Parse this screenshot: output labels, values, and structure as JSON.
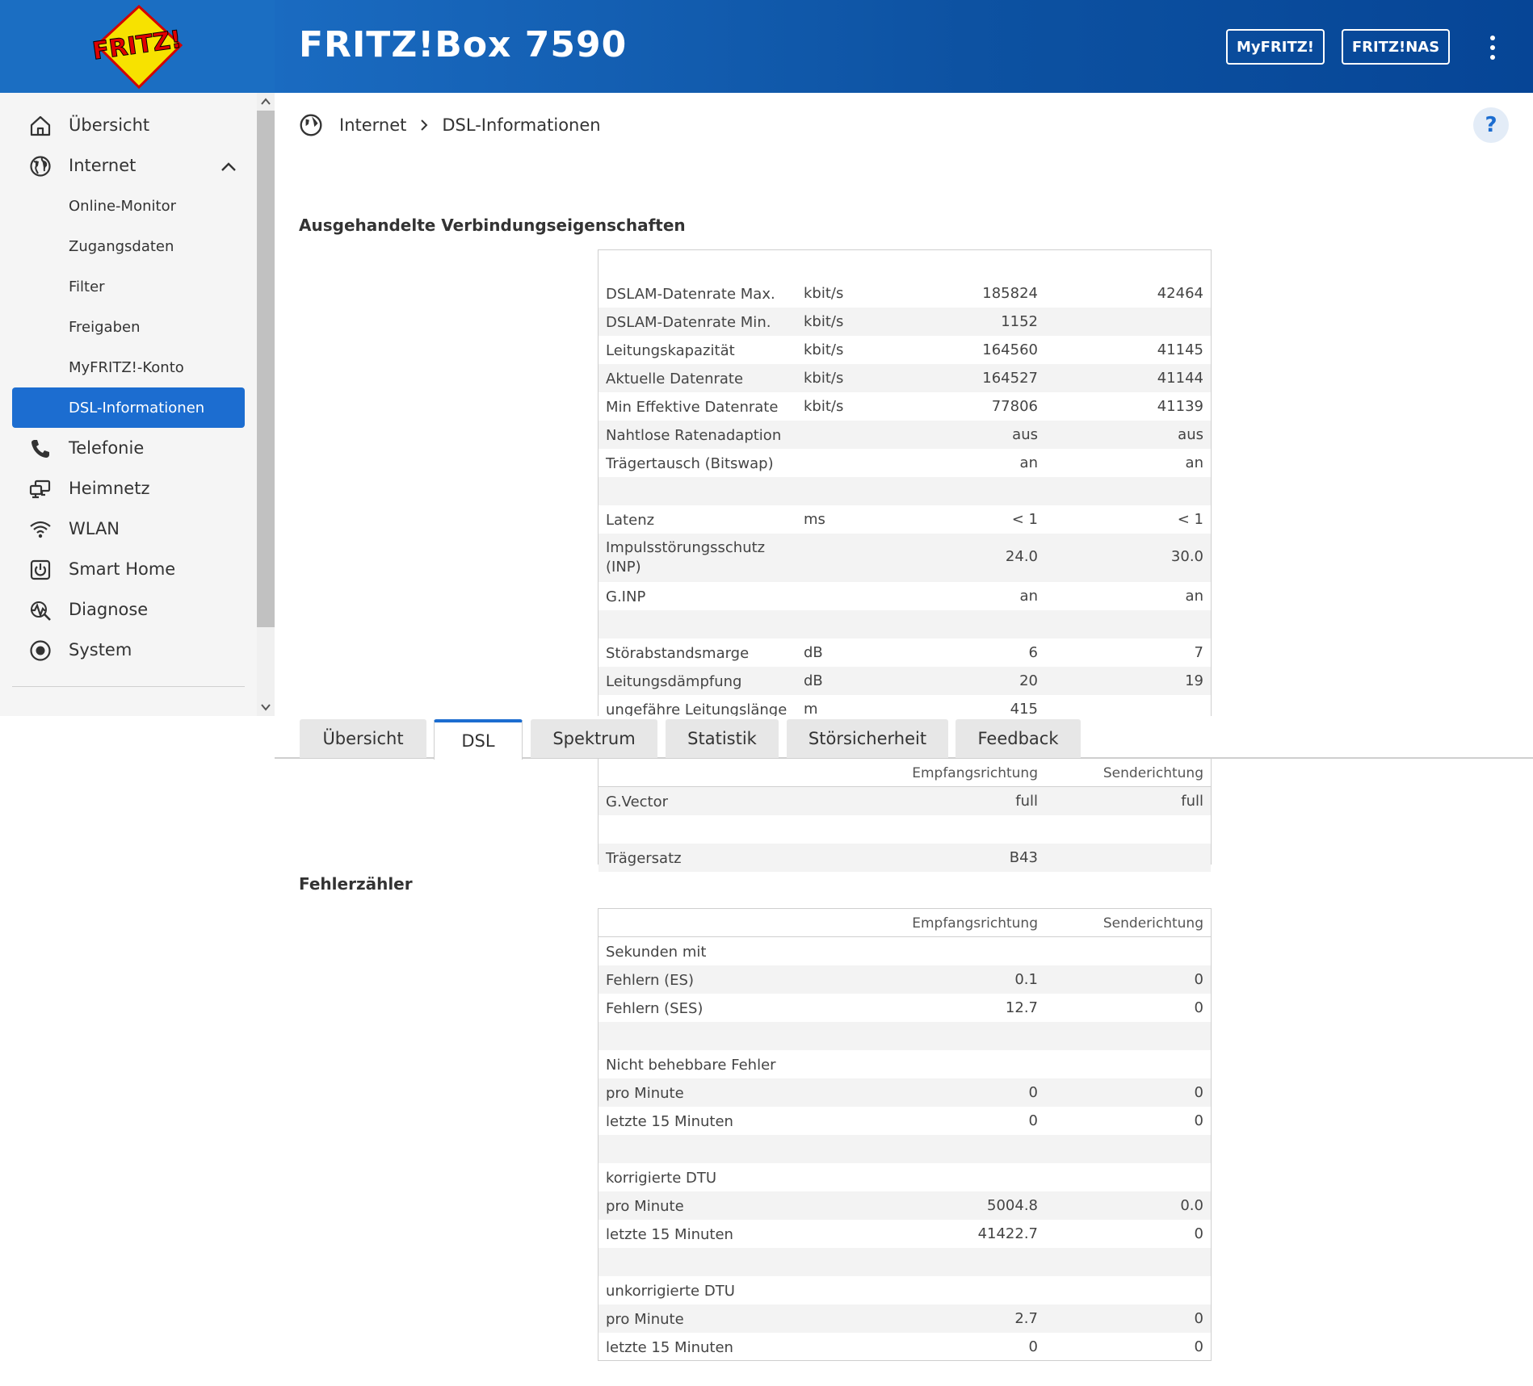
{
  "header": {
    "logo_text": "FRITZ!",
    "product_title": "FRITZ!Box 7590",
    "buttons": [
      "MyFRITZ!",
      "FRITZ!NAS"
    ]
  },
  "sidebar": {
    "items": [
      {
        "label": "Übersicht",
        "icon": "home-icon"
      },
      {
        "label": "Internet",
        "icon": "globe-icon"
      },
      {
        "label": "Online-Monitor"
      },
      {
        "label": "Zugangsdaten"
      },
      {
        "label": "Filter"
      },
      {
        "label": "Freigaben"
      },
      {
        "label": "MyFRITZ!-Konto"
      },
      {
        "label": "DSL-Informationen",
        "active": true
      },
      {
        "label": "Telefonie",
        "icon": "phone-icon"
      },
      {
        "label": "Heimnetz",
        "icon": "network-icon"
      },
      {
        "label": "WLAN",
        "icon": "wifi-icon"
      },
      {
        "label": "Smart Home",
        "icon": "smarthome-icon"
      },
      {
        "label": "Diagnose",
        "icon": "diagnose-icon"
      },
      {
        "label": "System",
        "icon": "system-icon"
      }
    ]
  },
  "breadcrumb": {
    "parent": "Internet",
    "current": "DSL-Informationen"
  },
  "help_label": "?",
  "section1": {
    "title": "Ausgehandelte Verbindungseigenschaften",
    "rows": [
      {
        "label": "DSLAM-Datenrate Max.",
        "unit": "kbit/s",
        "rx": "185824",
        "tx": "42464"
      },
      {
        "label": "DSLAM-Datenrate Min.",
        "unit": "kbit/s",
        "rx": "1152",
        "tx": ""
      },
      {
        "label": "Leitungskapazität",
        "unit": "kbit/s",
        "rx": "164560",
        "tx": "41145"
      },
      {
        "label": "Aktuelle Datenrate",
        "unit": "kbit/s",
        "rx": "164527",
        "tx": "41144"
      },
      {
        "label": "Min Effektive Datenrate",
        "unit": "kbit/s",
        "rx": "77806",
        "tx": "41139"
      },
      {
        "label": "Nahtlose Ratenadaption",
        "unit": "",
        "rx": "aus",
        "tx": "aus"
      },
      {
        "label": "Trägertausch (Bitswap)",
        "unit": "",
        "rx": "an",
        "tx": "an"
      },
      {
        "label": "",
        "unit": "",
        "rx": "",
        "tx": ""
      },
      {
        "label": "Latenz",
        "unit": "ms",
        "rx": "< 1",
        "tx": "< 1"
      },
      {
        "label": "Impulsstörungsschutz (INP)",
        "unit": "",
        "rx": "24.0",
        "tx": "30.0"
      },
      {
        "label": "G.INP",
        "unit": "",
        "rx": "an",
        "tx": "an"
      },
      {
        "label": "",
        "unit": "",
        "rx": "",
        "tx": ""
      },
      {
        "label": "Störabstandsmarge",
        "unit": "dB",
        "rx": "6",
        "tx": "7"
      },
      {
        "label": "Leitungsdämpfung",
        "unit": "dB",
        "rx": "20",
        "tx": "19"
      },
      {
        "label": "ungefähre Leitungslänge",
        "unit": "m",
        "rx": "415",
        "tx": ""
      }
    ],
    "sticky_header": {
      "rx": "Empfangsrichtung",
      "tx": "Senderichtung"
    },
    "rows_after": [
      {
        "label": "G.Vector",
        "unit": "",
        "rx": "full",
        "tx": "full"
      },
      {
        "label": "",
        "unit": "",
        "rx": "",
        "tx": ""
      },
      {
        "label": "Trägersatz",
        "unit": "",
        "rx": "B43",
        "tx": ""
      }
    ]
  },
  "tabs": [
    "Übersicht",
    "DSL",
    "Spektrum",
    "Statistik",
    "Störsicherheit",
    "Feedback"
  ],
  "active_tab": "DSL",
  "section2": {
    "title": "Fehlerzähler",
    "header": {
      "rx": "Empfangsrichtung",
      "tx": "Senderichtung"
    },
    "rows": [
      {
        "label": "Sekunden mit",
        "rx": "",
        "tx": ""
      },
      {
        "label": "Fehlern (ES)",
        "rx": "0.1",
        "tx": "0"
      },
      {
        "label": "Fehlern (SES)",
        "rx": "12.7",
        "tx": "0"
      },
      {
        "label": "",
        "rx": "",
        "tx": ""
      },
      {
        "label": "Nicht behebbare Fehler",
        "rx": "",
        "tx": ""
      },
      {
        "label": "pro Minute",
        "rx": "0",
        "tx": "0"
      },
      {
        "label": "letzte 15 Minuten",
        "rx": "0",
        "tx": "0"
      },
      {
        "label": "",
        "rx": "",
        "tx": ""
      },
      {
        "label": "korrigierte DTU",
        "rx": "",
        "tx": ""
      },
      {
        "label": "pro Minute",
        "rx": "5004.8",
        "tx": "0.0"
      },
      {
        "label": "letzte 15 Minuten",
        "rx": "41422.7",
        "tx": "0"
      },
      {
        "label": "",
        "rx": "",
        "tx": ""
      },
      {
        "label": "unkorrigierte DTU",
        "rx": "",
        "tx": ""
      },
      {
        "label": "pro Minute",
        "rx": "2.7",
        "tx": "0"
      },
      {
        "label": "letzte 15 Minuten",
        "rx": "0",
        "tx": "0"
      }
    ]
  },
  "colors": {
    "header_blue": "#1a6bc1",
    "accent": "#1c6dd0",
    "sidebar_bg": "#f5f5f5"
  }
}
